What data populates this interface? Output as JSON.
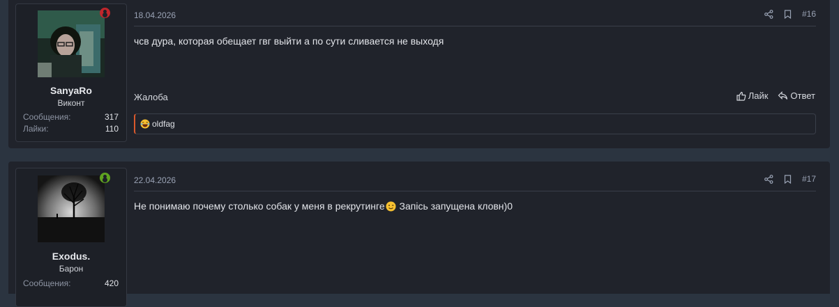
{
  "posts": [
    {
      "date": "18.04.2026",
      "number": "#16",
      "user": {
        "name": "SanyaRo",
        "title": "Виконт",
        "stats": [
          {
            "label": "Сообщения:",
            "value": "317"
          },
          {
            "label": "Лайки:",
            "value": "110"
          }
        ],
        "status_color": "#c0262c"
      },
      "message": "чсв дура, которая обещает гвг выйти а по сути сливается не выходя",
      "complain_label": "Жалоба",
      "like_label": "Лайк",
      "reply_label": "Ответ",
      "reactions": {
        "emoji_icon": "laughing-emoji-icon",
        "users": "oldfag"
      }
    },
    {
      "date": "22.04.2026",
      "number": "#17",
      "user": {
        "name": "Exodus.",
        "title": "Барон",
        "stats": [
          {
            "label": "Сообщения:",
            "value": "420"
          }
        ],
        "status_color": "#5fa320"
      },
      "message_part1": "Не понимаю почему столько собак у меня в рекрутинге",
      "message_emoji": "winking-emoji-icon",
      "message_part2": " Запісь запущена кловн)0"
    }
  ],
  "colors": {
    "page_bg": "#2b3440",
    "card_bg": "#20232b",
    "accent_reaction_border": "#d9582c"
  }
}
